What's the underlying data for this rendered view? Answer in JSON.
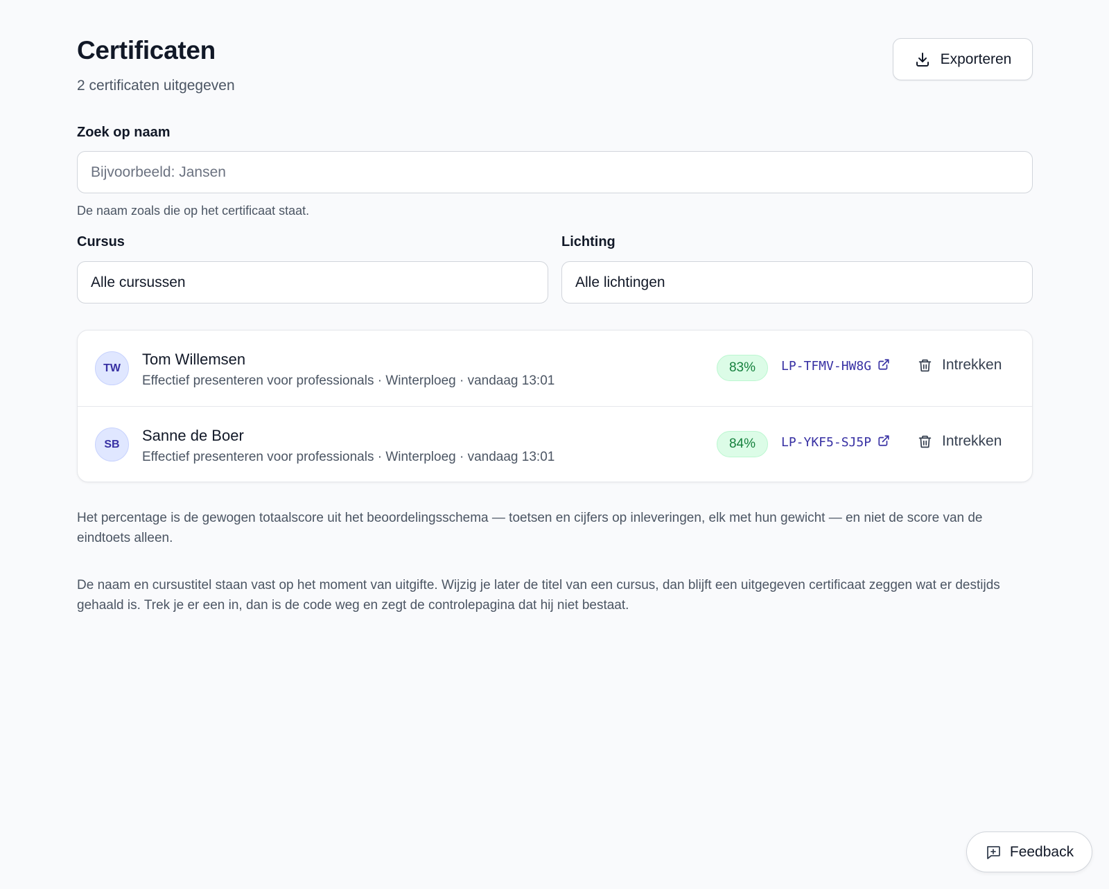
{
  "header": {
    "title": "Certificaten",
    "subtitle": "2 certificaten uitgegeven",
    "export_label": "Exporteren",
    "export_icon": "download-icon"
  },
  "search": {
    "label": "Zoek op naam",
    "value": "",
    "placeholder": "Bijvoorbeeld: Jansen",
    "hint": "De naam zoals die op het certificaat staat."
  },
  "filters": {
    "course_label": "Cursus",
    "course_value": "Alle cursussen",
    "cohort_label": "Lichting",
    "cohort_value": "Alle lichtingen"
  },
  "certificates": [
    {
      "initials": "TW",
      "name": "Tom Willemsen",
      "meta": "Effectief presenteren voor professionals · Winterploeg · vandaag 13:01",
      "score": "83%",
      "code": "LP-TFMV-HW8G",
      "revoke_label": "Intrekken"
    },
    {
      "initials": "SB",
      "name": "Sanne de Boer",
      "meta": "Effectief presenteren voor professionals · Winterploeg · vandaag 13:01",
      "score": "84%",
      "code": "LP-YKF5-SJ5P",
      "revoke_label": "Intrekken"
    }
  ],
  "notes": {
    "score": "Het percentage is de gewogen totaalscore uit het beoordelingsschema — toetsen en cijfers op inleveringen, elk met hun gewicht — en niet de score van de eindtoets alleen.",
    "fixed": "De naam en cursustitel staan vast op het moment van uitgifte. Wijzig je later de titel van een cursus, dan blijft een uitgegeven certificaat zeggen wat er destijds gehaald is. Trek je er een in, dan is de code weg en zegt de controlepagina dat hij niet bestaat."
  },
  "feedback": {
    "label": "Feedback",
    "icon": "message-plus-icon"
  },
  "colors": {
    "background": "#f9fafc",
    "accent": "#3730a3",
    "score_badge_bg": "#dcfce7",
    "score_badge_text": "#15803d"
  }
}
